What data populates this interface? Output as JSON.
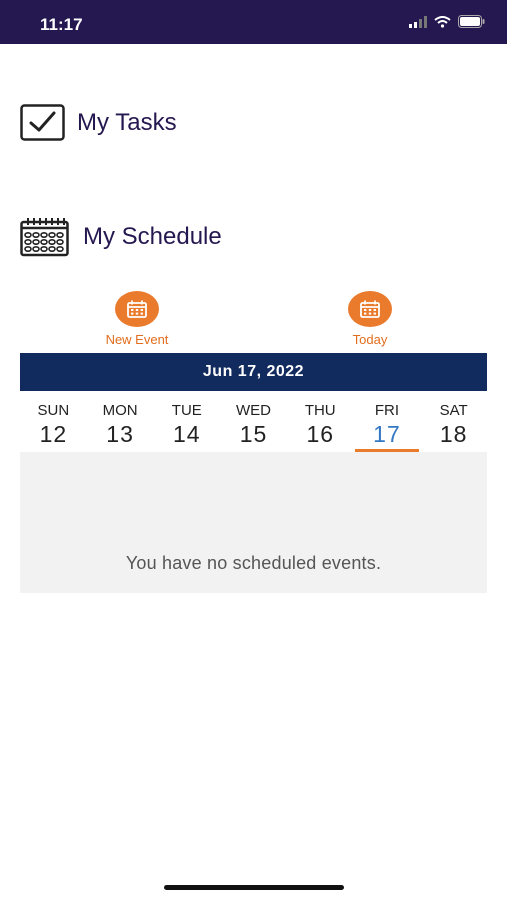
{
  "status_bar": {
    "time": "11:17"
  },
  "tasks": {
    "title": "My Tasks",
    "icon": "checkbox-icon"
  },
  "schedule": {
    "title": "My Schedule",
    "icon": "calendar-icon",
    "new_event_label": "New Event",
    "today_label": "Today",
    "current_date": "Jun 17, 2022",
    "days": [
      {
        "name": "SUN",
        "num": "12"
      },
      {
        "name": "MON",
        "num": "13"
      },
      {
        "name": "TUE",
        "num": "14"
      },
      {
        "name": "WED",
        "num": "15"
      },
      {
        "name": "THU",
        "num": "16"
      },
      {
        "name": "FRI",
        "num": "17"
      },
      {
        "name": "SAT",
        "num": "18"
      }
    ],
    "selected_day": "FRI",
    "empty_message": "You have no scheduled events."
  },
  "colors": {
    "header": "#25174f",
    "accent": "#ea7a2c",
    "date_banner": "#112b5e",
    "selected_day": "#3478c4"
  }
}
